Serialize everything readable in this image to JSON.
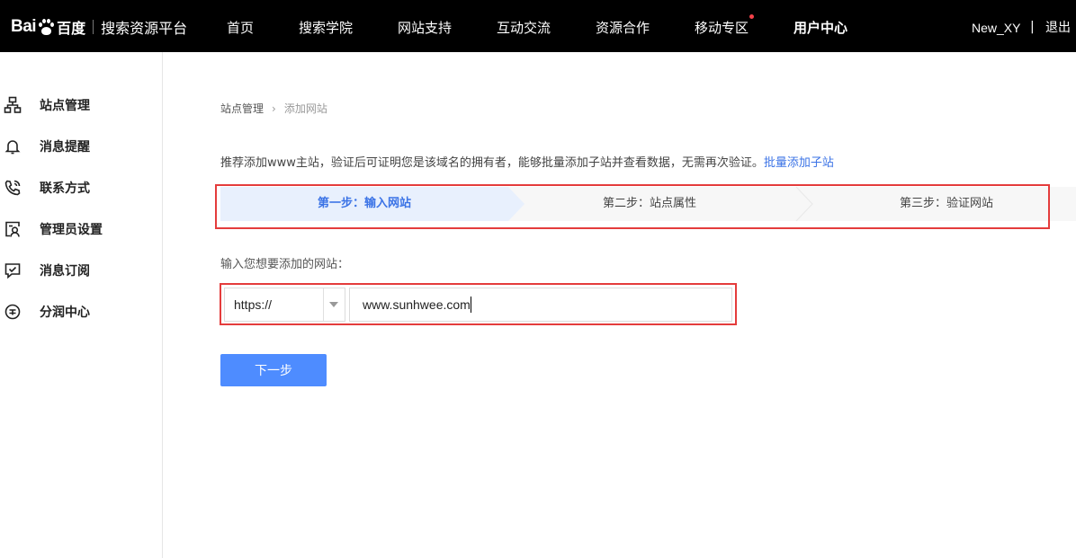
{
  "header": {
    "logo": {
      "bai": "Bai",
      "du_cn": "百度",
      "product": "搜索资源平台"
    },
    "nav": [
      {
        "label": "首页",
        "active": false,
        "dot": false
      },
      {
        "label": "搜索学院",
        "active": false,
        "dot": false
      },
      {
        "label": "网站支持",
        "active": false,
        "dot": false
      },
      {
        "label": "互动交流",
        "active": false,
        "dot": false
      },
      {
        "label": "资源合作",
        "active": false,
        "dot": false
      },
      {
        "label": "移动专区",
        "active": false,
        "dot": true
      },
      {
        "label": "用户中心",
        "active": true,
        "dot": false
      }
    ],
    "username": "New_XY",
    "separator": "|",
    "logout": "退出"
  },
  "sidebar": {
    "items": [
      {
        "label": "站点管理",
        "icon": "sitemap-icon"
      },
      {
        "label": "消息提醒",
        "icon": "bell-icon"
      },
      {
        "label": "联系方式",
        "icon": "phone-icon"
      },
      {
        "label": "管理员设置",
        "icon": "admin-user-icon"
      },
      {
        "label": "消息订阅",
        "icon": "message-check-icon"
      },
      {
        "label": "分润中心",
        "icon": "revenue-icon"
      }
    ]
  },
  "breadcrumb": {
    "parent": "站点管理",
    "current": "添加网站"
  },
  "tip": {
    "text": "推荐添加www主站，验证后可证明您是该域名的拥有者，能够批量添加子站并查看数据，无需再次验证。",
    "link": "批量添加子站"
  },
  "steps": [
    {
      "label": "第一步：输入网站",
      "active": true
    },
    {
      "label": "第二步：站点属性",
      "active": false
    },
    {
      "label": "第三步：验证网站",
      "active": false
    }
  ],
  "form": {
    "label": "输入您想要添加的网站：",
    "protocol": "https://",
    "url_value": "www.sunhwee.com",
    "next_button": "下一步"
  },
  "colors": {
    "topbar": "#000000",
    "accent": "#3b73e6",
    "button": "#4e8cff",
    "highlight_box": "#e43c3c",
    "step_active_bg": "#e8f0fd",
    "notification_dot": "#f5424a"
  }
}
